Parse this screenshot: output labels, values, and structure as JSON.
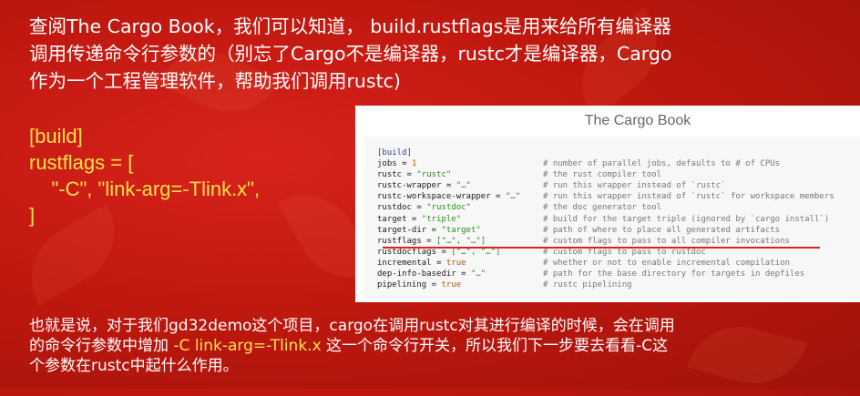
{
  "intro": {
    "line1": "查阅The Cargo Book，我们可以知道， build.rustflags是用来给所有编译器",
    "line2": "调用传递命令行参数的（别忘了Cargo不是编译器，rustc才是编译器，Cargo",
    "line3": "作为一个工程管理软件，帮助我们调用rustc)"
  },
  "config": {
    "l1": "[build]",
    "l2": "rustflags = [",
    "l3": "    \"-C\", \"link-arg=-Tlink.x\",",
    "l4": "]"
  },
  "cargo_book": {
    "title": "The Cargo Book",
    "section": "[build]",
    "rows": [
      {
        "key": "jobs = ",
        "val": "1",
        "vtype": "n",
        "comment": "# number of parallel jobs, defaults to # of CPUs"
      },
      {
        "key": "rustc = ",
        "val": "\"rustc\"",
        "vtype": "s",
        "comment": "# the rust compiler tool"
      },
      {
        "key": "rustc-wrapper = ",
        "val": "\"…\"",
        "vtype": "s",
        "comment": "# run this wrapper instead of `rustc`"
      },
      {
        "key": "rustc-workspace-wrapper = ",
        "val": "\"…\"",
        "vtype": "s",
        "comment": "# run this wrapper instead of `rustc` for workspace members"
      },
      {
        "key": "rustdoc = ",
        "val": "\"rustdoc\"",
        "vtype": "s",
        "comment": "# the doc generator tool"
      },
      {
        "key": "target = ",
        "val": "\"triple\"",
        "vtype": "s",
        "comment": "# build for the target triple (ignored by `cargo install`)"
      },
      {
        "key": "target-dir = ",
        "val": "\"target\"",
        "vtype": "s",
        "comment": "# path of where to place all generated artifacts"
      },
      {
        "key": "rustflags = ",
        "val": "[\"…\", \"…\"]",
        "vtype": "s",
        "comment": "# custom flags to pass to all compiler invocations"
      },
      {
        "key": "rustdocflags = ",
        "val": "[\"…\", \"…\"]",
        "vtype": "s",
        "comment": "# custom flags to pass to rustdoc"
      },
      {
        "key": "incremental = ",
        "val": "true",
        "vtype": "n",
        "comment": "# whether or not to enable incremental compilation"
      },
      {
        "key": "dep-info-basedir = ",
        "val": "\"…\"",
        "vtype": "s",
        "comment": "# path for the base directory for targets in depfiles"
      },
      {
        "key": "pipelining = ",
        "val": "true",
        "vtype": "n",
        "comment": "# rustc pipelining"
      }
    ]
  },
  "bottom": {
    "line1": "也就是说，对于我们gd32demo这个项目，cargo在调用rustc对其进行编译的时候，会在调用",
    "line2_a": "的命令行参数中增加 ",
    "line2_hl": "-C link-arg=-Tlink.x",
    "line2_b": " 这一个命令行开关，所以我们下一步要去看看-C这",
    "line3": "个参数在rustc中起什么作用。"
  },
  "colors": {
    "background": "#c0180f",
    "highlight": "#ffe14a",
    "text": "#ffffff"
  }
}
